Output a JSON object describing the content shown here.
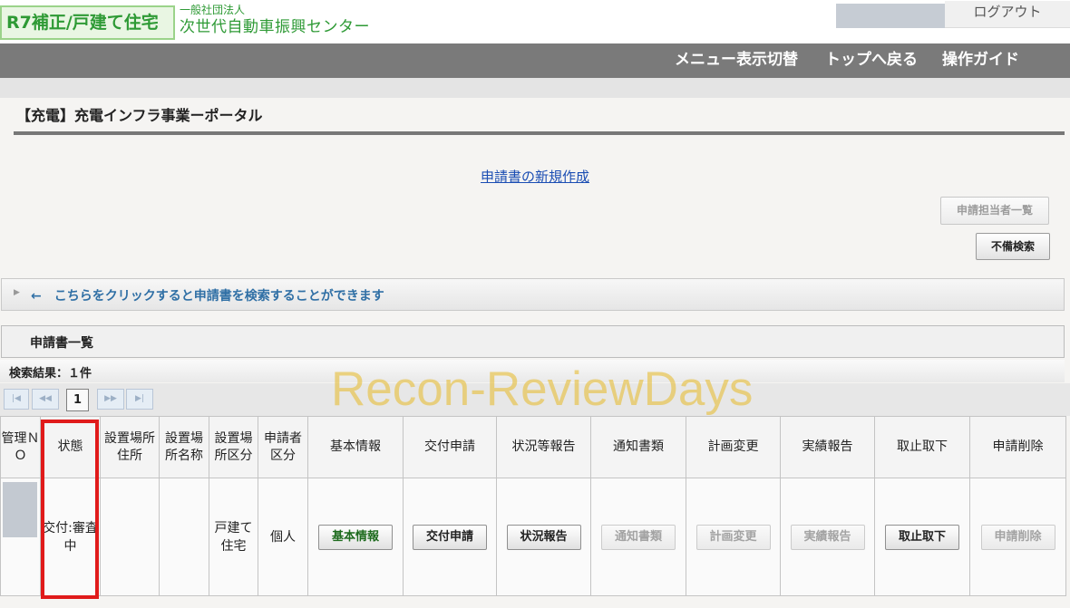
{
  "header": {
    "program_label": "R7補正/戸建て住宅",
    "org_small": "一般社団法人",
    "org_name": "次世代自動車振興センター",
    "logout_label": "ログアウト"
  },
  "nav": {
    "items": [
      "メニュー表示切替",
      "トップへ戻る",
      "操作ガイド"
    ]
  },
  "page": {
    "title": "【充電】充電インフラ事業ーポータル",
    "new_application_link": "申請書の新規作成",
    "applicant_list_button": "申請担当者一覧",
    "defect_search_button": "不備検索",
    "search_toggle_text": "←　こちらをクリックすると申請書を検索することができます"
  },
  "list": {
    "title": "申請書一覧",
    "result_label": "検索結果：１件",
    "current_page": "1",
    "columns": [
      "管理ＮＯ",
      "状態",
      "設置場所住所",
      "設置場所名称",
      "設置場所区分",
      "申請者区分",
      "基本情報",
      "交付申請",
      "状況等報告",
      "通知書類",
      "計画変更",
      "実績報告",
      "取止取下",
      "申請削除"
    ],
    "rows": [
      {
        "status": "交付:審査中",
        "address": "",
        "place_name": "",
        "place_category": "戸建て住宅",
        "applicant_category": "個人",
        "buttons": {
          "basic_info": "基本情報",
          "grant_application": "交付申請",
          "status_report": "状況報告",
          "notice_documents": "通知書類",
          "plan_change": "計画変更",
          "results_report": "実績報告",
          "withdrawal": "取止取下",
          "delete": "申請削除"
        }
      }
    ]
  },
  "watermark": "Recon-ReviewDays",
  "colors": {
    "brand_green": "#2e9a35",
    "nav_gray": "#7a7a7a",
    "link_blue": "#1a4db3",
    "highlight_red": "#e01a1a",
    "watermark_gold": "#e6be3c"
  }
}
